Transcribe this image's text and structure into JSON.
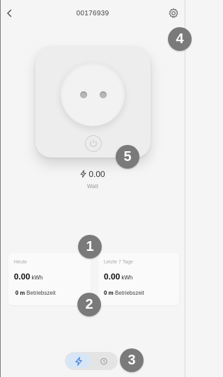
{
  "header": {
    "title": "00176939"
  },
  "power": {
    "value": "0.00",
    "unit": "Watt"
  },
  "cards": {
    "today": {
      "label": "Heute",
      "value": "0.00",
      "unit": "kWh",
      "runtime_value": "0 m",
      "runtime_label": "Betriebszeit"
    },
    "week": {
      "label": "Letzte 7 Tage",
      "value": "0.00",
      "unit": "kWh",
      "runtime_value": "0 m",
      "runtime_label": "Betriebszeit"
    }
  },
  "toggle": {
    "active": "power",
    "power_icon": "lightning-icon",
    "history_icon": "clock-icon",
    "active_color": "#d7e6f7",
    "icon_color": "#3a7ad6"
  },
  "badges": [
    "1",
    "2",
    "3",
    "4",
    "5"
  ],
  "icons": {
    "back": "chevron-left-icon",
    "settings": "gear-icon",
    "power_button": "power-icon"
  }
}
